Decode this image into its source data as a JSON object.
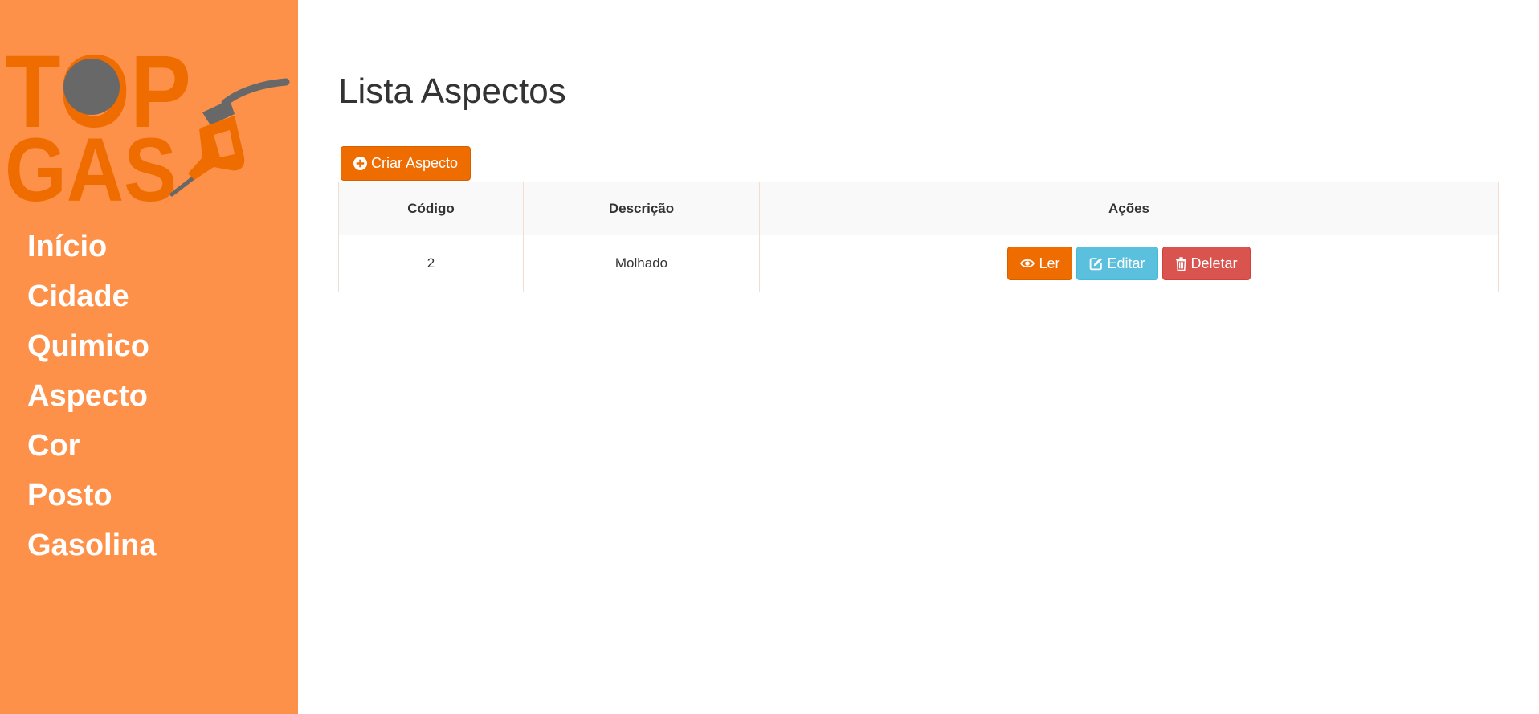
{
  "brand": {
    "logo_text_top": "TOP",
    "logo_text_bottom": "GAS",
    "primary_color": "#fe914a",
    "accent_color": "#ee6c00"
  },
  "sidebar": {
    "items": [
      {
        "label": "Início"
      },
      {
        "label": "Cidade"
      },
      {
        "label": "Quimico"
      },
      {
        "label": "Aspecto"
      },
      {
        "label": "Cor"
      },
      {
        "label": "Posto"
      },
      {
        "label": "Gasolina"
      }
    ]
  },
  "main": {
    "title": "Lista Aspectos",
    "create_button": {
      "label": "Criar Aspecto",
      "icon": "plus-circle-icon"
    },
    "table": {
      "columns": [
        "Código",
        "Descrição",
        "Ações"
      ],
      "rows": [
        {
          "codigo": "2",
          "descricao": "Molhado"
        }
      ],
      "actions": {
        "read": {
          "label": "Ler",
          "icon": "eye-icon",
          "color": "#ee6c00"
        },
        "edit": {
          "label": "Editar",
          "icon": "edit-icon",
          "color": "#5bc0de"
        },
        "delete": {
          "label": "Deletar",
          "icon": "trash-icon",
          "color": "#d9534f"
        }
      }
    }
  }
}
